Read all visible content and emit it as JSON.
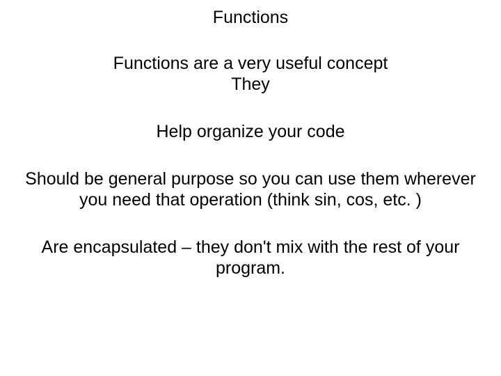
{
  "title": "Functions",
  "intro_line1": "Functions are a very useful concept",
  "intro_line2": "They",
  "point1": "Help organize your code",
  "point2": "Should be general purpose so you can use them wherever you need that operation (think sin, cos, etc. )",
  "point3": "Are encapsulated – they don't mix with the rest of your program."
}
